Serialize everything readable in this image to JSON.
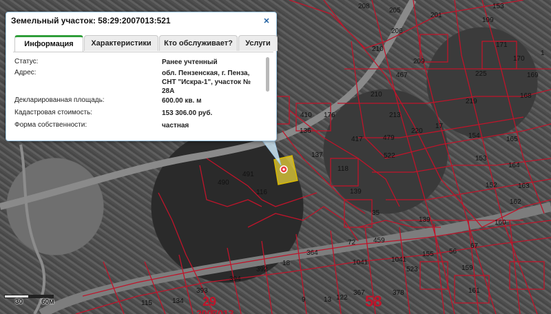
{
  "popup": {
    "title": "Земельный участок: 58:29:2007013:521",
    "close_glyph": "✕",
    "tabs": [
      {
        "label": "Информация",
        "active": true
      },
      {
        "label": "Характеристики",
        "active": false
      },
      {
        "label": "Кто обслуживает?",
        "active": false
      },
      {
        "label": "Услуги",
        "active": false
      }
    ],
    "rows": [
      {
        "label": "Статус:",
        "value": "Ранее учтенный"
      },
      {
        "label": "Адрес:",
        "value": "обл. Пензенская, г. Пенза, СНТ \"Искра-1\", участок № 28А"
      },
      {
        "label": "Декларированная площадь:",
        "value": "600.00 кв. м"
      },
      {
        "label": "Кадастровая стоимость:",
        "value": "153 306.00 руб."
      },
      {
        "label": "Форма собственности:",
        "value": "частная"
      }
    ]
  },
  "map": {
    "parcel_numbers": [
      "208",
      "210",
      "206",
      "205",
      "201",
      "199",
      "153",
      "170",
      "169",
      "168",
      "171",
      "1",
      "467",
      "210",
      "213",
      "219",
      "225",
      "209",
      "176",
      "136",
      "410",
      "417",
      "479",
      "220",
      "17",
      "154",
      "165",
      "137",
      "522",
      "118",
      "491",
      "116",
      "490",
      "153",
      "164",
      "139",
      "163",
      "162",
      "35",
      "152",
      "160",
      "459",
      "139",
      "155",
      "56",
      "67",
      "72",
      "523",
      "159",
      "161",
      "392",
      "18",
      "364",
      "1041",
      "1041",
      "394",
      "393",
      "134",
      "378",
      "367",
      "122",
      "9",
      "13",
      "115"
    ],
    "quarter_labels": [
      "29",
      "58",
      "2007013"
    ],
    "colors": {
      "parcel_line": "#c0142a",
      "selected_fill": "#e8d23a",
      "popup_tab_accent": "#2f9e3a"
    }
  },
  "scale": {
    "label_30": "30",
    "label_60": "60м"
  }
}
